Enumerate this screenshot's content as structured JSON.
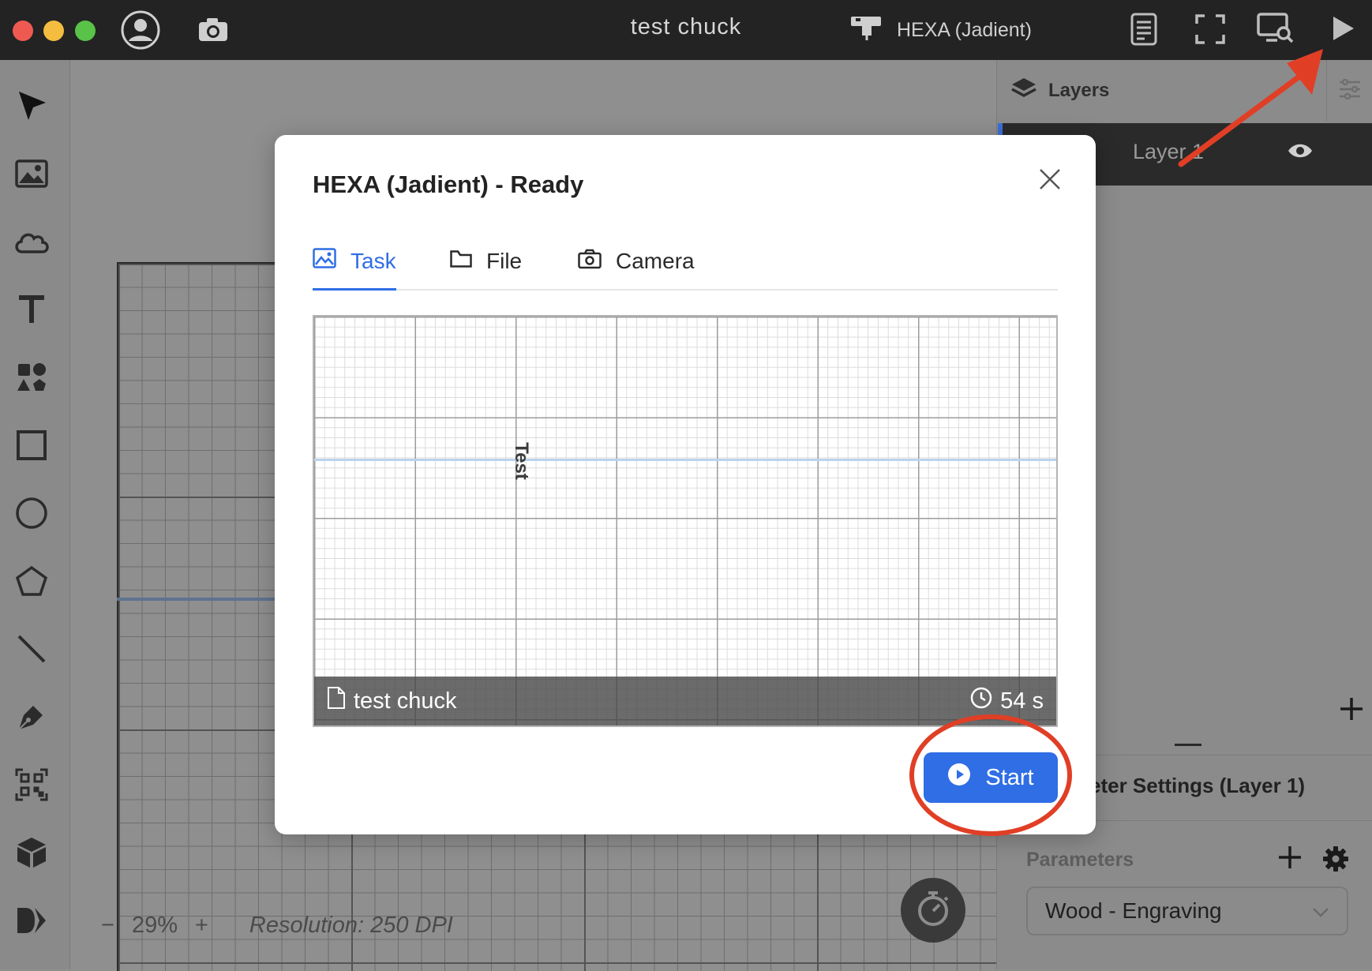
{
  "window": {
    "title": "test chuck",
    "device_name": "HEXA (Jadient)"
  },
  "colors": {
    "accent": "#2f6ee5",
    "annotation_red": "#e03f26",
    "titlebar": "#232323"
  },
  "toolbar": {
    "tools": [
      "pointer-icon",
      "image-icon",
      "cloud-icon",
      "text-icon",
      "shapes-icon",
      "rectangle-icon",
      "ellipse-icon",
      "polygon-icon",
      "line-icon",
      "pen-icon",
      "qrcode-icon",
      "box-3d-icon",
      "dxf-icon"
    ]
  },
  "canvas": {
    "zoom": "29%",
    "zoom_minus": "−",
    "zoom_plus": "+",
    "resolution": "Resolution: 250 DPI"
  },
  "layers_panel": {
    "title": "Layers",
    "layer_name": "Layer 1",
    "add_label": "+"
  },
  "parameter_panel": {
    "title": "eter Settings (Layer 1)",
    "parameters_label": "Parameters",
    "preset": "Wood - Engraving"
  },
  "modal": {
    "title": "HEXA (Jadient) - Ready",
    "tabs": [
      {
        "label": "Task",
        "active": true
      },
      {
        "label": "File"
      },
      {
        "label": "Camera"
      }
    ],
    "preview": {
      "text": "Test",
      "file_name": "test chuck",
      "duration": "54 s"
    },
    "start_label": "Start"
  }
}
